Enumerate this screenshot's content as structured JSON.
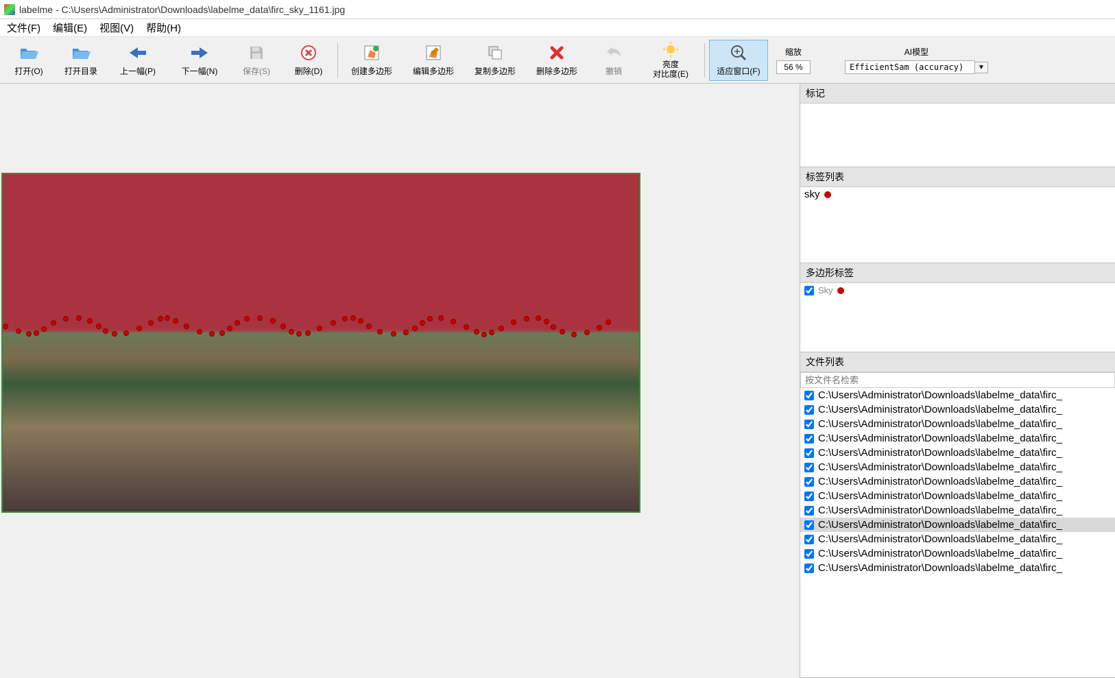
{
  "window": {
    "title": "labelme - C:\\Users\\Administrator\\Downloads\\labelme_data\\firc_sky_1161.jpg"
  },
  "menu": {
    "file": "文件(F)",
    "edit": "编辑(E)",
    "view": "视图(V)",
    "help": "帮助(H)"
  },
  "toolbar": {
    "open": "打开(O)",
    "open_dir": "打开目录",
    "prev": "上一幅(P)",
    "next": "下一幅(N)",
    "save": "保存(S)",
    "delete": "删除(D)",
    "create_poly": "创建多边形",
    "edit_poly": "编辑多边形",
    "copy_poly": "复制多边形",
    "delete_poly": "删除多边形",
    "undo": "撤销",
    "brightness": "亮度\n对比度(E)",
    "fit_window": "适应窗口(F)",
    "zoom_label": "缩放",
    "zoom_value": "56 %",
    "ai_label": "AI模型",
    "ai_value": "EfficientSam (accuracy)"
  },
  "panels": {
    "flags_header": "标记",
    "labels_header": "标签列表",
    "labels": [
      {
        "name": "sky"
      }
    ],
    "poly_header": "多边形标签",
    "poly_items": [
      {
        "name": "Sky",
        "checked": true
      }
    ],
    "files_header": "文件列表",
    "search_placeholder": "按文件名检索",
    "files": [
      {
        "path": "C:\\Users\\Administrator\\Downloads\\labelme_data\\firc_",
        "checked": true,
        "selected": false
      },
      {
        "path": "C:\\Users\\Administrator\\Downloads\\labelme_data\\firc_",
        "checked": true,
        "selected": false
      },
      {
        "path": "C:\\Users\\Administrator\\Downloads\\labelme_data\\firc_",
        "checked": true,
        "selected": false
      },
      {
        "path": "C:\\Users\\Administrator\\Downloads\\labelme_data\\firc_",
        "checked": true,
        "selected": false
      },
      {
        "path": "C:\\Users\\Administrator\\Downloads\\labelme_data\\firc_",
        "checked": true,
        "selected": false
      },
      {
        "path": "C:\\Users\\Administrator\\Downloads\\labelme_data\\firc_",
        "checked": true,
        "selected": false
      },
      {
        "path": "C:\\Users\\Administrator\\Downloads\\labelme_data\\firc_",
        "checked": true,
        "selected": false
      },
      {
        "path": "C:\\Users\\Administrator\\Downloads\\labelme_data\\firc_",
        "checked": true,
        "selected": false
      },
      {
        "path": "C:\\Users\\Administrator\\Downloads\\labelme_data\\firc_",
        "checked": true,
        "selected": false
      },
      {
        "path": "C:\\Users\\Administrator\\Downloads\\labelme_data\\firc_",
        "checked": true,
        "selected": true
      },
      {
        "path": "C:\\Users\\Administrator\\Downloads\\labelme_data\\firc_",
        "checked": true,
        "selected": false
      },
      {
        "path": "C:\\Users\\Administrator\\Downloads\\labelme_data\\firc_",
        "checked": true,
        "selected": false
      },
      {
        "path": "C:\\Users\\Administrator\\Downloads\\labelme_data\\firc_",
        "checked": true,
        "selected": false
      }
    ]
  }
}
